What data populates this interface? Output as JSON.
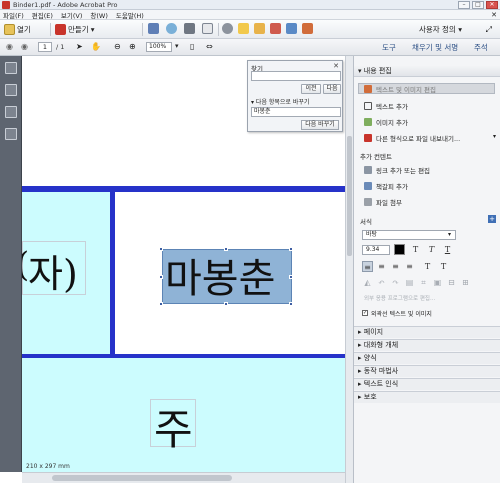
{
  "window": {
    "title": "Binder1.pdf - Adobe Acrobat Pro"
  },
  "menu": [
    "파일(F)",
    "편집(E)",
    "보기(V)",
    "창(W)",
    "도움말(H)"
  ],
  "toolbar": {
    "open": "열기",
    "create": "만들기",
    "user_defined": "사용자 정의"
  },
  "nav": {
    "page_current": "1",
    "page_total": "/ 1",
    "zoom": "100%"
  },
  "right_links": {
    "tools": "도구",
    "sign": "채우기 및 서명",
    "comment": "주석"
  },
  "find": {
    "title": "찾기",
    "prev": "이전",
    "next": "다음",
    "replace_label": "다음 항목으로 바꾸기",
    "replace_value": "마봉춘",
    "replace_button": "다음 바꾸기"
  },
  "document": {
    "text_left": "자)",
    "text_left_prefix": "(",
    "text_selected": "마봉춘",
    "text_bottom": "주",
    "page_size": "210 x 297 mm",
    "colors": {
      "band": "#ccfcfe",
      "line": "#2632c9"
    }
  },
  "panel": {
    "edit_header": "내용 편집",
    "edit_items": [
      "텍스트 및 이미지 편집",
      "텍스트 추가",
      "이미지 추가",
      "다른 형식으로 파일 내보내기..."
    ],
    "add_content_header": "추가 컨텐트",
    "add_items": [
      "링크 추가 또는 편집",
      "책갈피 추가",
      "파일 첨부"
    ],
    "format_label": "서식",
    "font": "바탕",
    "size": "9.34",
    "outline_label": "외곽선 텍스트 및 이미지",
    "sections": [
      "페이지",
      "대화형 개체",
      "양식",
      "동작 마법사",
      "텍스트 인식",
      "보호"
    ]
  }
}
